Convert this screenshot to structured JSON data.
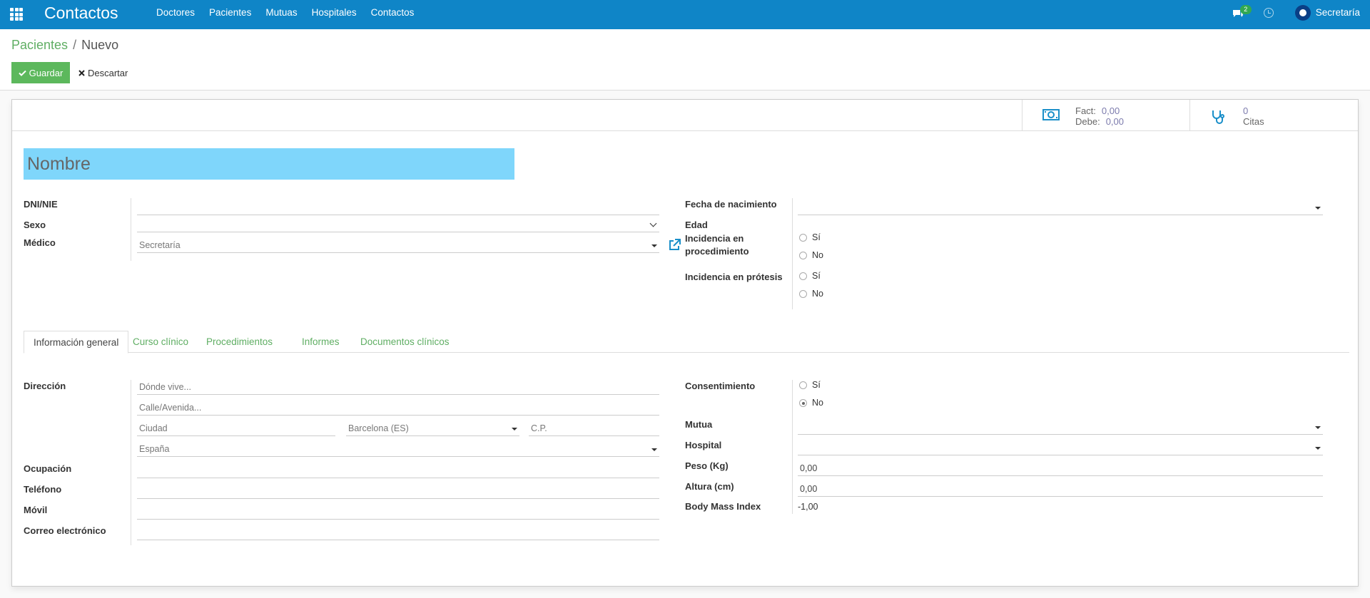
{
  "navbar": {
    "app_title": "Contactos",
    "menu": [
      "Doctores",
      "Pacientes",
      "Mutuas",
      "Hospitales",
      "Contactos"
    ],
    "chat_count": "2",
    "user_name": "Secretaría",
    "bar_color": "#0f85c7"
  },
  "breadcrumb": {
    "parent": "Pacientes",
    "separator": "/",
    "current": "Nuevo"
  },
  "actions": {
    "save_label": "Guardar",
    "discard_label": "Descartar"
  },
  "stats": {
    "fact_label": "Fact:",
    "fact_value": "0,00",
    "debe_label": "Debe:",
    "debe_value": "0,00",
    "citas_count": "0",
    "citas_label": "Citas"
  },
  "name_placeholder": "Nombre",
  "left_fields": {
    "dni_label": "DNI/NIE",
    "sexo_label": "Sexo",
    "medico_label": "Médico",
    "medico_value": "Secretaría"
  },
  "right_fields": {
    "fecha_label": "Fecha de nacimiento",
    "edad_label": "Edad",
    "incidencia_proc_label": "Incidencia en procedimiento",
    "incidencia_prot_label": "Incidencia en prótesis",
    "yes": "Sí",
    "no": "No"
  },
  "tabs": [
    "Información general",
    "Curso clínico",
    "Procedimientos",
    "Informes",
    "Documentos clínicos"
  ],
  "general": {
    "direccion_label": "Dirección",
    "donde_vive_placeholder": "Dónde vive...",
    "calle_placeholder": "Calle/Avenida...",
    "ciudad_placeholder": "Ciudad",
    "provincia_value": "Barcelona (ES)",
    "cp_placeholder": "C.P.",
    "pais_value": "España",
    "ocupacion_label": "Ocupación",
    "telefono_label": "Teléfono",
    "movil_label": "Móvil",
    "correo_label": "Correo electrónico",
    "consentimiento_label": "Consentimiento",
    "consentimiento_selected": "No",
    "mutua_label": "Mutua",
    "hospital_label": "Hospital",
    "peso_label": "Peso (Kg)",
    "peso_value": "0,00",
    "altura_label": "Altura (cm)",
    "altura_value": "0,00",
    "bmi_label": "Body Mass Index",
    "bmi_value": "-1,00"
  }
}
